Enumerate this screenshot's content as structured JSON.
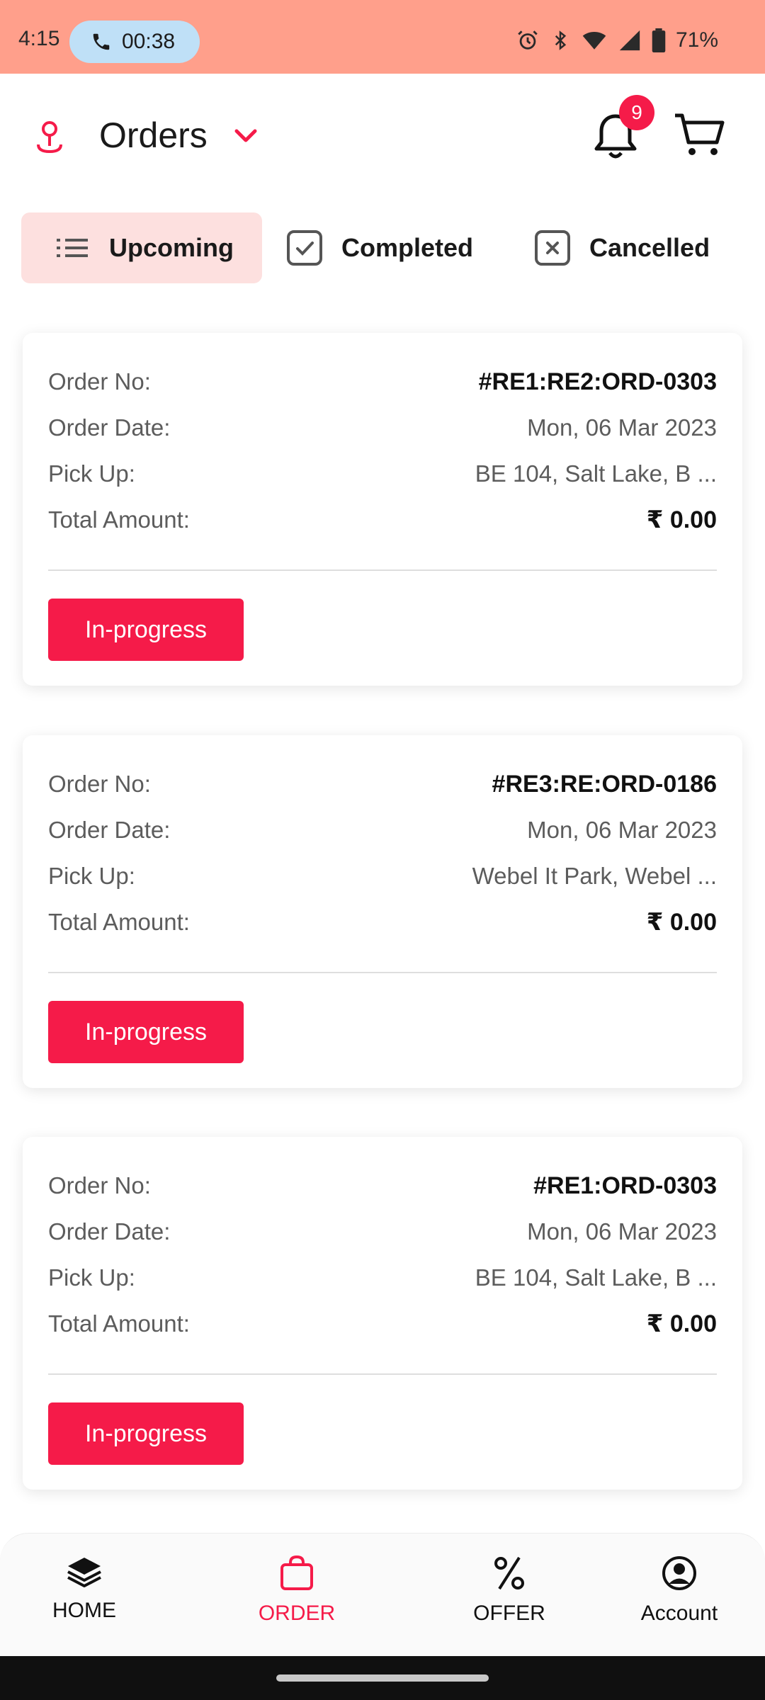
{
  "status_bar": {
    "time": "4:15",
    "call_duration": "00:38",
    "battery": "71%"
  },
  "header": {
    "title": "Orders",
    "notification_count": "9"
  },
  "tabs": [
    {
      "label": "Upcoming",
      "active": true
    },
    {
      "label": "Completed",
      "active": false
    },
    {
      "label": "Cancelled",
      "active": false
    }
  ],
  "labels": {
    "order_no": "Order No:",
    "order_date": "Order Date:",
    "pick_up": "Pick Up:",
    "total_amount": "Total Amount:"
  },
  "orders": [
    {
      "order_no": "#RE1:RE2:ORD-0303",
      "order_date": "Mon, 06 Mar 2023",
      "pick_up": "BE 104, Salt Lake, B ...",
      "total_amount": "₹ 0.00",
      "status": "In-progress"
    },
    {
      "order_no": "#RE3:RE:ORD-0186",
      "order_date": "Mon, 06 Mar 2023",
      "pick_up": "Webel It Park, Webel ...",
      "total_amount": "₹ 0.00",
      "status": "In-progress"
    },
    {
      "order_no": "#RE1:ORD-0303",
      "order_date": "Mon, 06 Mar 2023",
      "pick_up": "BE 104, Salt Lake, B ...",
      "total_amount": "₹ 0.00",
      "status": "In-progress"
    }
  ],
  "bottom_nav": [
    {
      "label": "HOME",
      "icon": "layers-icon",
      "active": false
    },
    {
      "label": "ORDER",
      "icon": "bag-icon",
      "active": true
    },
    {
      "label": "OFFER",
      "icon": "percent-icon",
      "active": false
    },
    {
      "label": "Account",
      "icon": "account-circle-icon",
      "active": false
    }
  ],
  "colors": {
    "accent": "#f51b49",
    "status_bar": "#ff9f8b",
    "active_tab_bg": "#fde0df",
    "call_pill": "#bfe0f7"
  }
}
